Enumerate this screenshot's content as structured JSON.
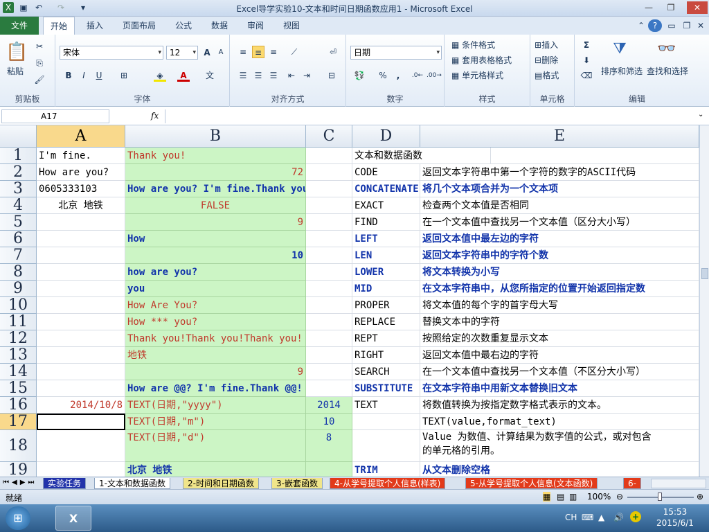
{
  "window": {
    "title": "Excel导学实验10-文本和时间日期函数应用1 - Microsoft Excel"
  },
  "ribbon_tabs": [
    "文件",
    "开始",
    "插入",
    "页面布局",
    "公式",
    "数据",
    "审阅",
    "视图"
  ],
  "ribbon": {
    "clipboard": {
      "paste": "粘贴",
      "label": "剪贴板"
    },
    "font": {
      "name": "宋体",
      "size": "12",
      "label": "字体",
      "bold": "B",
      "italic": "I",
      "underline": "U"
    },
    "alignment": {
      "label": "对齐方式"
    },
    "number": {
      "format": "日期",
      "label": "数字",
      "percent": "%"
    },
    "styles": {
      "cond": "条件格式",
      "table": "套用表格格式",
      "cell": "单元格样式",
      "label": "样式"
    },
    "cells": {
      "insert": "插入",
      "delete": "删除",
      "format": "格式",
      "label": "单元格"
    },
    "editing": {
      "sort": "排序和筛选",
      "find": "查找和选择",
      "label": "编辑",
      "sum": "Σ"
    }
  },
  "formula_bar": {
    "name_box": "A17",
    "fx": "fx",
    "value": ""
  },
  "columns": [
    "A",
    "B",
    "C",
    "D",
    "E"
  ],
  "rows": [
    {
      "n": "1",
      "a": "I'm fine.",
      "b": "Thank you!",
      "c": "",
      "d": "文本和数据函数",
      "e": ""
    },
    {
      "n": "2",
      "a": "How are you?",
      "b": "72",
      "c": "",
      "d": "CODE",
      "e": "返回文本字符串中第一个字符的数字的ASCII代码"
    },
    {
      "n": "3",
      "a": "0605333103",
      "b": "How are you? I'm fine.Thank you!",
      "c": "",
      "d": "CONCATENATE",
      "e": "将几个文本项合并为一个文本项"
    },
    {
      "n": "4",
      "a": "北京  地铁",
      "b": "FALSE",
      "c": "",
      "d": "EXACT",
      "e": "检查两个文本值是否相同"
    },
    {
      "n": "5",
      "a": "",
      "b": "9",
      "c": "",
      "d": "FIND",
      "e": "在一个文本值中查找另一个文本值（区分大小写）"
    },
    {
      "n": "6",
      "a": "",
      "b": "How",
      "c": "",
      "d": "LEFT",
      "e": "返回文本值中最左边的字符"
    },
    {
      "n": "7",
      "a": "",
      "b": "10",
      "c": "",
      "d": "LEN",
      "e": "返回文本字符串中的字符个数"
    },
    {
      "n": "8",
      "a": "",
      "b": "how are you?",
      "c": "",
      "d": "LOWER",
      "e": "将文本转换为小写"
    },
    {
      "n": "9",
      "a": "",
      "b": "you",
      "c": "",
      "d": "MID",
      "e": "在文本字符串中，从您所指定的位置开始返回指定数"
    },
    {
      "n": "10",
      "a": "",
      "b": "How Are You?",
      "c": "",
      "d": "PROPER",
      "e": "将文本值的每个字的首字母大写"
    },
    {
      "n": "11",
      "a": "",
      "b": "How *** you?",
      "c": "",
      "d": "REPLACE",
      "e": "替换文本中的字符"
    },
    {
      "n": "12",
      "a": "",
      "b": "Thank you!Thank you!Thank you!",
      "c": "",
      "d": "REPT",
      "e": "按照给定的次数重复显示文本"
    },
    {
      "n": "13",
      "a": "",
      "b": "地铁",
      "c": "",
      "d": "RIGHT",
      "e": "返回文本值中最右边的字符"
    },
    {
      "n": "14",
      "a": "",
      "b": "9",
      "c": "",
      "d": "SEARCH",
      "e": "在一个文本值中查找另一个文本值（不区分大小写）"
    },
    {
      "n": "15",
      "a": "",
      "b": "How are @@? I'm fine.Thank @@!",
      "c": "",
      "d": "SUBSTITUTE",
      "e": "在文本字符串中用新文本替换旧文本"
    },
    {
      "n": "16",
      "a": "2014/10/8",
      "b": "TEXT(日期,\"yyyy\")",
      "c": "2014",
      "d": "TEXT",
      "e": "将数值转换为按指定数字格式表示的文本。"
    },
    {
      "n": "17",
      "a": "",
      "b": "TEXT(日期,\"m\")",
      "c": "10",
      "d": "",
      "e": "TEXT(value,format_text)"
    },
    {
      "n": "18",
      "a": "",
      "b": "TEXT(日期,\"d\")",
      "c": "8",
      "d": "",
      "e": "Value    为数值、计算结果为数字值的公式，或对包含",
      "e2": "的单元格的引用。"
    },
    {
      "n": "19",
      "a": "",
      "b": "北京 地铁",
      "c": "",
      "d": "TRIM",
      "e": "从文本删除空格"
    }
  ],
  "sheet_tabs": [
    "实验任务",
    "1-文本和数据函数",
    "2-时间和日期函数",
    "3-嵌套函数",
    "4-从学号提取个人信息(样表)",
    "5-从学号提取个人信息(文本函数)",
    "6-"
  ],
  "status": {
    "ready": "就绪",
    "zoom": "100%"
  },
  "taskbar": {
    "time": "15:53",
    "date": "2015/6/1",
    "lang": "CH"
  }
}
